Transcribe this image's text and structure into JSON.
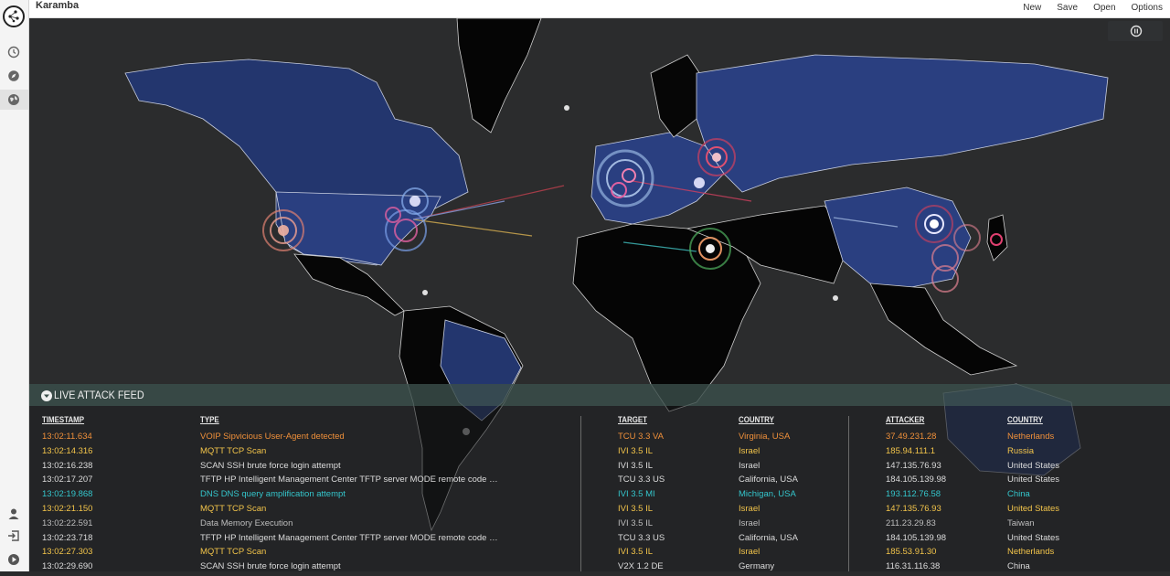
{
  "app": {
    "title": "Karamba"
  },
  "menu": {
    "items": [
      "New",
      "Save",
      "Open",
      "Options"
    ]
  },
  "sidebar": {
    "top_icons": [
      "history-icon",
      "compass-icon",
      "globe-icon"
    ],
    "bottom_icons": [
      "user-icon",
      "logout-icon",
      "play-icon"
    ]
  },
  "map": {
    "control_icon": "pause-icon"
  },
  "feed": {
    "title": "LIVE ATTACK FEED",
    "headers": {
      "timestamp": "TIMESTAMP",
      "type": "TYPE",
      "target": "TARGET",
      "target_country": "COUNTRY",
      "attacker": "ATTACKER",
      "attacker_country": "COUNTRY"
    },
    "rows": [
      {
        "timestamp": "13:02:11.634",
        "type": "VOIP Sipvicious User-Agent detected",
        "target": "TCU 3.3 VA",
        "target_country": "Virginia, USA",
        "attacker": "37.49.231.28",
        "attacker_country": "Netherlands",
        "color": "orange"
      },
      {
        "timestamp": "13:02:14.316",
        "type": "MQTT TCP Scan",
        "target": "IVI 3.5 IL",
        "target_country": "Israel",
        "attacker": "185.94.111.1",
        "attacker_country": "Russia",
        "color": "yellow"
      },
      {
        "timestamp": "13:02:16.238",
        "type": "SCAN SSH brute force login attempt",
        "target": "IVI 3.5 IL",
        "target_country": "Israel",
        "attacker": "147.135.76.93",
        "attacker_country": "United States",
        "color": "white"
      },
      {
        "timestamp": "13:02:17.207",
        "type": "TFTP HP Intelligent Management Center TFTP server MODE remote code execution attempt",
        "target": "TCU 3.3 US",
        "target_country": "California, USA",
        "attacker": "184.105.139.98",
        "attacker_country": "United States",
        "color": "white"
      },
      {
        "timestamp": "13:02:19.868",
        "type": "DNS DNS query amplification attempt",
        "target": "IVI 3.5 MI",
        "target_country": "Michigan, USA",
        "attacker": "193.112.76.58",
        "attacker_country": "China",
        "color": "cyan"
      },
      {
        "timestamp": "13:02:21.150",
        "type": "MQTT TCP Scan",
        "target": "IVI 3.5 IL",
        "target_country": "Israel",
        "attacker": "147.135.76.93",
        "attacker_country": "United States",
        "color": "yellow"
      },
      {
        "timestamp": "13:02:22.591",
        "type": "Data Memory Execution",
        "target": "IVI 3.5 IL",
        "target_country": "Israel",
        "attacker": "211.23.29.83",
        "attacker_country": "Taiwan",
        "color": "grey"
      },
      {
        "timestamp": "13:02:23.718",
        "type": "TFTP HP Intelligent Management Center TFTP server MODE remote code execution attempt",
        "target": "TCU 3.3 US",
        "target_country": "California, USA",
        "attacker": "184.105.139.98",
        "attacker_country": "United States",
        "color": "white"
      },
      {
        "timestamp": "13:02:27.303",
        "type": "MQTT TCP Scan",
        "target": "IVI 3.5 IL",
        "target_country": "Israel",
        "attacker": "185.53.91.30",
        "attacker_country": "Netherlands",
        "color": "yellow"
      },
      {
        "timestamp": "13:02:29.690",
        "type": "SCAN SSH brute force login attempt",
        "target": "V2X 1.2 DE",
        "target_country": "Germany",
        "attacker": "116.31.116.38",
        "attacker_country": "China",
        "color": "white"
      }
    ]
  }
}
